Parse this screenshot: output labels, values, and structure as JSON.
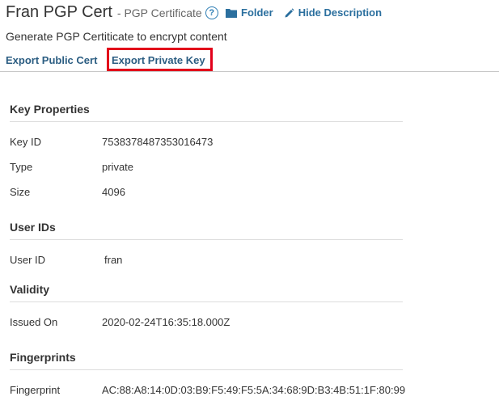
{
  "header": {
    "title": "Fran PGP Cert",
    "subtitle": "- PGP Certificate",
    "help_glyph": "?",
    "folder_label": "Folder",
    "hide_description_label": "Hide Description",
    "icons": {
      "help": "help-icon",
      "folder": "folder-icon",
      "hide_description": "pencil-icon"
    }
  },
  "description": "Generate PGP Certiticate to encrypt content",
  "actions": {
    "export_public": "Export Public Cert",
    "export_private": "Export Private Key",
    "highlight_color": "#e2001a"
  },
  "colors": {
    "link": "#2b6f9e",
    "text": "#333333"
  },
  "sections": {
    "key_properties": {
      "title": "Key Properties",
      "rows": [
        {
          "label": "Key ID",
          "value": "7538378487353016473"
        },
        {
          "label": "Type",
          "value": "private"
        },
        {
          "label": "Size",
          "value": "4096"
        }
      ]
    },
    "user_ids": {
      "title": "User IDs",
      "rows": [
        {
          "label": "User ID",
          "value": "fran"
        }
      ]
    },
    "validity": {
      "title": "Validity",
      "rows": [
        {
          "label": "Issued On",
          "value": "2020-02-24T16:35:18.000Z"
        }
      ]
    },
    "fingerprints": {
      "title": "Fingerprints",
      "rows": [
        {
          "label": "Fingerprint",
          "value": "AC:88:A8:14:0D:03:B9:F5:49:F5:5A:34:68:9D:B3:4B:51:1F:80:99"
        }
      ]
    }
  }
}
